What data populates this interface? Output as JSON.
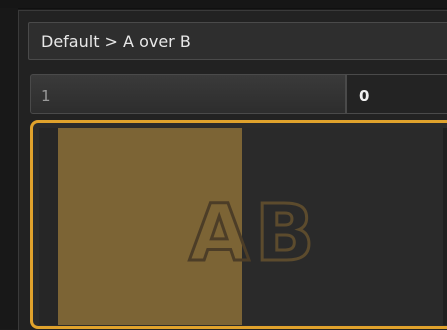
{
  "breadcrumb": {
    "text": "Default > A over B"
  },
  "fields": {
    "left_value": "1",
    "right_value": "0"
  },
  "preview": {
    "logo_letters": [
      "A",
      "B"
    ],
    "colors": {
      "highlight_border": "#e0a22c",
      "a_region": "#7c6435",
      "b_region": "#2a2a2a"
    }
  }
}
